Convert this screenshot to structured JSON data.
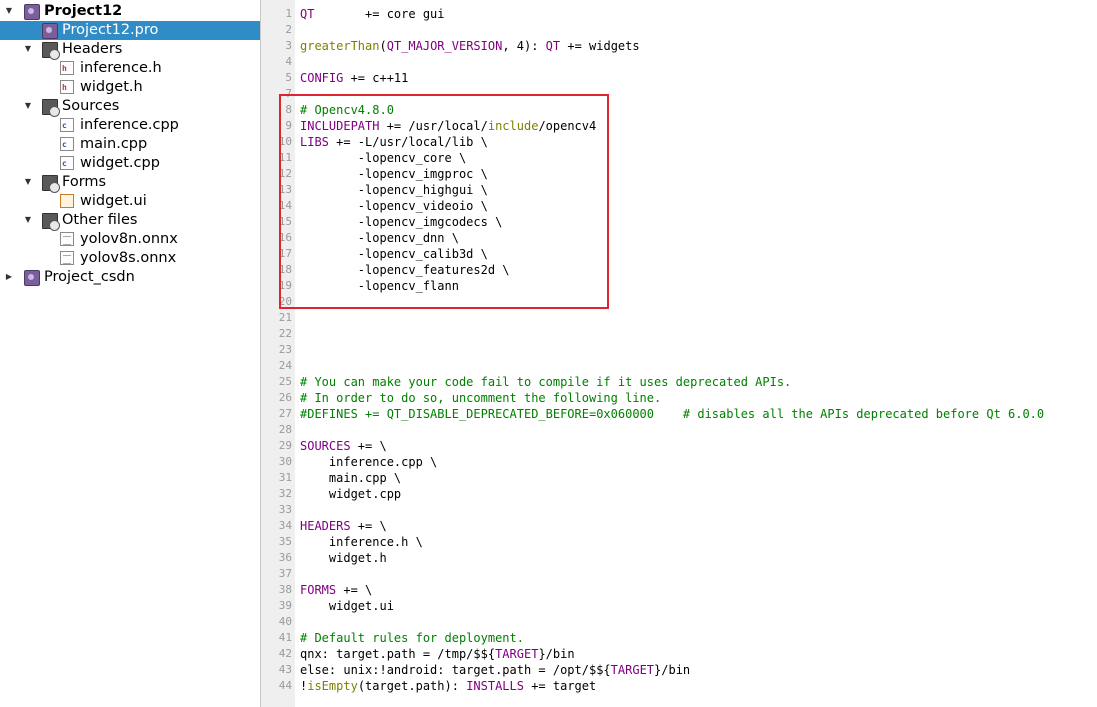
{
  "colors": {
    "selection_bg": "#308cc6",
    "keyword": "#800080",
    "function": "#808000",
    "comment": "#008000",
    "highlight_box": "#e0232e"
  },
  "project_tree": {
    "items": [
      {
        "label": "Project12",
        "icon": "qt-project-icon",
        "level": 0,
        "expanded": true,
        "bold": true
      },
      {
        "label": "Project12.pro",
        "icon": "pro-file-icon",
        "level": 1,
        "selected": true
      },
      {
        "label": "Headers",
        "icon": "headers-folder-icon",
        "level": 1,
        "expanded": true
      },
      {
        "label": "inference.h",
        "icon": "header-file-icon",
        "level": 2
      },
      {
        "label": "widget.h",
        "icon": "header-file-icon",
        "level": 2
      },
      {
        "label": "Sources",
        "icon": "sources-folder-icon",
        "level": 1,
        "expanded": true
      },
      {
        "label": "inference.cpp",
        "icon": "cpp-file-icon",
        "level": 2
      },
      {
        "label": "main.cpp",
        "icon": "cpp-file-icon",
        "level": 2
      },
      {
        "label": "widget.cpp",
        "icon": "cpp-file-icon",
        "level": 2
      },
      {
        "label": "Forms",
        "icon": "forms-folder-icon",
        "level": 1,
        "expanded": true
      },
      {
        "label": "widget.ui",
        "icon": "ui-file-icon",
        "level": 2
      },
      {
        "label": "Other files",
        "icon": "other-files-folder-icon",
        "level": 1,
        "expanded": true
      },
      {
        "label": "yolov8n.onnx",
        "icon": "text-file-icon",
        "level": 2
      },
      {
        "label": "yolov8s.onnx",
        "icon": "text-file-icon",
        "level": 2
      },
      {
        "label": "Project_csdn",
        "icon": "qt-project-icon",
        "level": 0,
        "expanded": false
      }
    ]
  },
  "editor": {
    "line_numbers": [
      "1",
      "2",
      "3",
      "4",
      "5",
      "7",
      "8",
      "9",
      "10",
      "11",
      "12",
      "13",
      "14",
      "15",
      "16",
      "17",
      "18",
      "19",
      "20",
      "21",
      "22",
      "23",
      "24",
      "25",
      "26",
      "27",
      "28",
      "29",
      "30",
      "31",
      "32",
      "33",
      "34",
      "35",
      "36",
      "37",
      "38",
      "39",
      "40",
      "41",
      "42",
      "43",
      "44"
    ],
    "lines": [
      [
        {
          "t": "QT",
          "c": "kw"
        },
        {
          "t": "       += core gui"
        }
      ],
      [],
      [
        {
          "t": "greaterThan",
          "c": "fn"
        },
        {
          "t": "("
        },
        {
          "t": "QT_MAJOR_VERSION",
          "c": "kw"
        },
        {
          "t": ", 4): "
        },
        {
          "t": "QT",
          "c": "kw"
        },
        {
          "t": " += widgets"
        }
      ],
      [],
      [
        {
          "t": "CONFIG",
          "c": "kw"
        },
        {
          "t": " += c++11"
        }
      ],
      [],
      [
        {
          "t": "# Opencv4.8.0",
          "c": "cm"
        }
      ],
      [
        {
          "t": "INCLUDEPATH",
          "c": "kw"
        },
        {
          "t": " += /usr/local/"
        },
        {
          "t": "include",
          "c": "fn"
        },
        {
          "t": "/opencv4"
        }
      ],
      [
        {
          "t": "LIBS",
          "c": "kw"
        },
        {
          "t": " += -L/usr/local/lib \\"
        }
      ],
      [
        {
          "t": "        -lopencv_core \\"
        }
      ],
      [
        {
          "t": "        -lopencv_imgproc \\"
        }
      ],
      [
        {
          "t": "        -lopencv_highgui \\"
        }
      ],
      [
        {
          "t": "        -lopencv_videoio \\"
        }
      ],
      [
        {
          "t": "        -lopencv_imgcodecs \\"
        }
      ],
      [
        {
          "t": "        -lopencv_dnn \\"
        }
      ],
      [
        {
          "t": "        -lopencv_calib3d \\"
        }
      ],
      [
        {
          "t": "        -lopencv_features2d \\"
        }
      ],
      [
        {
          "t": "        -lopencv_flann"
        }
      ],
      [],
      [],
      [],
      [],
      [],
      [
        {
          "t": "# You can make your code fail to compile if it uses deprecated APIs.",
          "c": "cm"
        }
      ],
      [
        {
          "t": "# In order to do so, uncomment the following line.",
          "c": "cm"
        }
      ],
      [
        {
          "t": "#DEFINES += QT_DISABLE_DEPRECATED_BEFORE=0x060000    # disables all the APIs deprecated before Qt 6.0.0",
          "c": "cm"
        }
      ],
      [],
      [
        {
          "t": "SOURCES",
          "c": "kw"
        },
        {
          "t": " += \\"
        }
      ],
      [
        {
          "t": "    inference.cpp \\"
        }
      ],
      [
        {
          "t": "    main.cpp \\"
        }
      ],
      [
        {
          "t": "    widget.cpp"
        }
      ],
      [],
      [
        {
          "t": "HEADERS",
          "c": "kw"
        },
        {
          "t": " += \\"
        }
      ],
      [
        {
          "t": "    inference.h \\"
        }
      ],
      [
        {
          "t": "    widget.h"
        }
      ],
      [],
      [
        {
          "t": "FORMS",
          "c": "kw"
        },
        {
          "t": " += \\"
        }
      ],
      [
        {
          "t": "    widget.ui"
        }
      ],
      [],
      [
        {
          "t": "# Default rules for deployment.",
          "c": "cm"
        }
      ],
      [
        {
          "t": "qnx: target.path = /tmp/$${"
        },
        {
          "t": "TARGET",
          "c": "kw"
        },
        {
          "t": "}/bin"
        }
      ],
      [
        {
          "t": "else: unix:!android: target.path = /opt/$${"
        },
        {
          "t": "TARGET",
          "c": "kw"
        },
        {
          "t": "}/bin"
        }
      ],
      [
        {
          "t": "!"
        },
        {
          "t": "isEmpty",
          "c": "fn"
        },
        {
          "t": "(target.path): "
        },
        {
          "t": "INSTALLS",
          "c": "kw"
        },
        {
          "t": " += target"
        }
      ]
    ]
  }
}
